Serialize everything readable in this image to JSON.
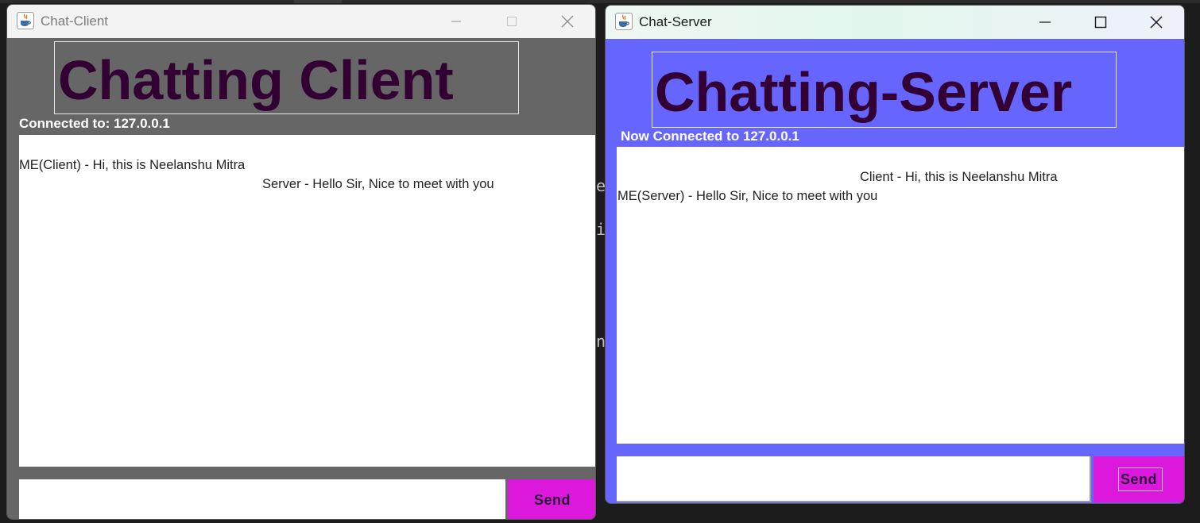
{
  "client": {
    "window_title": "Chat-Client",
    "headline": "Chatting Client",
    "status": "Connected to: 127.0.0.1",
    "messages": [
      {
        "text": "ME(Client) - Hi, this is Neelanshu Mitra",
        "align": "left"
      },
      {
        "text": "Server - Hello Sir, Nice to meet with you",
        "align": "right"
      }
    ],
    "input_value": "",
    "send_label": "Send",
    "colors": {
      "panel_bg": "#666666",
      "headline": "#330033",
      "send_bg": "#dd18dd"
    }
  },
  "server": {
    "window_title": "Chat-Server",
    "headline": "Chatting-Server",
    "status": "Now Connected to 127.0.0.1",
    "messages": [
      {
        "text": "Client - Hi, this is Neelanshu Mitra",
        "align": "right"
      },
      {
        "text": "ME(Server) - Hello Sir, Nice to meet with you",
        "align": "left"
      }
    ],
    "input_value": "",
    "send_label": "Send",
    "colors": {
      "panel_bg": "#6666ff",
      "headline": "#330033",
      "send_bg": "#dd18dd"
    }
  },
  "icons": {
    "app": "java-coffee-cup-icon",
    "minimize": "minimize-icon",
    "maximize": "maximize-icon",
    "close": "close-icon"
  },
  "background_terminal_chars": [
    "e",
    "i",
    "n"
  ]
}
